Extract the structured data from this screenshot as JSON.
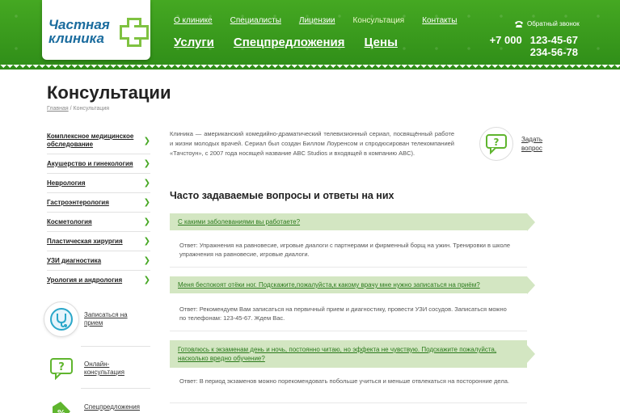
{
  "logo": {
    "line1": "Частная",
    "line2": "клиника"
  },
  "topnav": [
    "О клинике",
    "Специалисты",
    "Лицензии",
    "Консультация",
    "Контакты"
  ],
  "mainnav": [
    "Услуги",
    "Спецпредложения",
    "Цены"
  ],
  "header": {
    "callback_label": "Обратный звонок",
    "phone_code": "+7 000",
    "phone_1": "123-45-67",
    "phone_2": "234-56-78"
  },
  "page": {
    "title": "Консультации",
    "breadcrumb_home": "Главная",
    "breadcrumb_sep": " / ",
    "breadcrumb_current": "Консультация"
  },
  "sidebar": {
    "items": [
      "Комплексное медицинское обследование",
      "Акушерство и гинекология",
      "Неврология",
      "Гастроэнтерология",
      "Косметология",
      "Пластическая хирургия",
      "УЗИ диагностика",
      "Урология и андрология"
    ],
    "promos": [
      "Записаться на прием",
      "Онлайн-консультация",
      "Спецпредложения на услуги"
    ]
  },
  "intro": "Клиника — американский комедийно-драматический телевизионный сериал, посвящённый работе и жизни молодых врачей. Сериал был создан Биллом Лоуренсом и спродюсирован телекомпанией «Тачстоун», с 2007 года носящей название ABC Studios и входящей в компанию ABC).",
  "ask_label": "Задать вопрос",
  "faq": {
    "title": "Часто задаваемые вопросы и ответы на них",
    "items": [
      {
        "q": "С какими заболеваниями вы работаете?",
        "a": "Ответ: Упражнения на равновесие, игровые диалоги с партнерами и фирменный борщ на ужин. Тренировки в школе упражнения на равновесие, игровые диалоги."
      },
      {
        "q": "Меня беспокоят отёки ног. Подскажите,пожалуйста,к какому врачу мне нужно записаться на приём?",
        "a": "Ответ: Рекомендуем Вам записаться на первичный прием и диагностику, провести УЗИ сосудов. Записаться можно по телефонам: 123-45-67. Ждем Вас."
      },
      {
        "q": "Готовлюсь к экзаменам день и ночь, постоянно читаю, но эффекта не чувствую. Подскажите пожалуйста, насколько вредно обучение?",
        "a": "Ответ: В период экзаменов можно порекомендовать побольше учиться и меньше отвлекаться на посторонние дела."
      }
    ]
  },
  "colors": {
    "green": "#3c9a1e",
    "light_green": "#d3e6c2",
    "accent": "#48a825"
  }
}
